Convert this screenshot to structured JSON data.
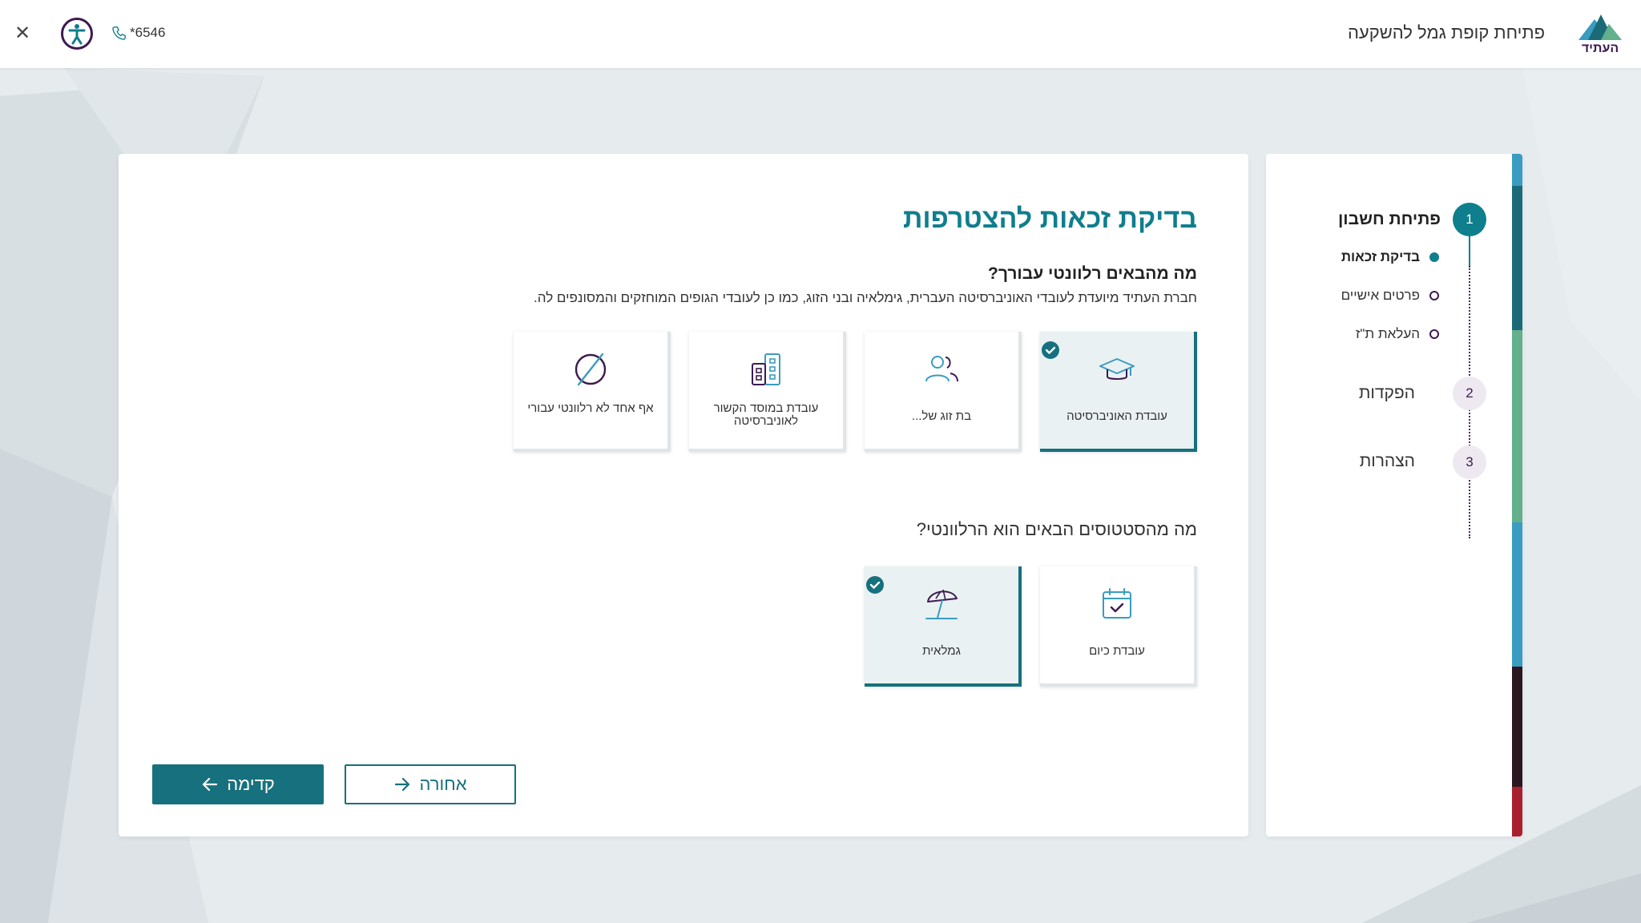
{
  "header": {
    "logo_text": "העתיד",
    "app_title": "פתיחת קופת גמל להשקעה",
    "phone": "*6546",
    "close_icon": "close-icon",
    "accessibility_icon": "accessibility-icon"
  },
  "stepper": {
    "steps": [
      {
        "number": "1",
        "label": "פתיחת חשבון",
        "active": true
      },
      {
        "number": "2",
        "label": "הפקדות",
        "active": false
      },
      {
        "number": "3",
        "label": "הצהרות",
        "active": false
      }
    ],
    "substeps": [
      {
        "label": "בדיקת זכאות",
        "current": true
      },
      {
        "label": "פרטים אישיים",
        "current": false
      },
      {
        "label": "העלאת ת\"ז",
        "current": false
      }
    ],
    "stripe_colors": [
      "#3a9cc0",
      "#1b6a78",
      "#62b08c",
      "#3a9cc0",
      "#2b1720",
      "#a8202e"
    ]
  },
  "main": {
    "title": "בדיקת זכאות להצטרפות",
    "question1": {
      "title": "מה מהבאים רלוונטי עבורך?",
      "description": "חברת העתיד מיועדת לעובדי האוניברסיטה העברית, גימלאיה ובני הזוג, כמו כן לעובדי הגופים המוחזקים והמסונפים לה.",
      "options": [
        {
          "label": "עובדת האוניברסיטה",
          "icon": "graduation-cap-icon",
          "selected": true
        },
        {
          "label": "בת זוג של...",
          "icon": "users-icon",
          "selected": false
        },
        {
          "label": "עובדת במוסד הקשור לאוניברסיטה",
          "icon": "building-icon",
          "selected": false
        },
        {
          "label": "אף אחד לא רלוונטי עבורי",
          "icon": "none-icon",
          "selected": false
        }
      ]
    },
    "question2": {
      "title": "מה מהסטטוסים הבאים הוא הרלוונטי?",
      "options": [
        {
          "label": "עובדת כיום",
          "icon": "calendar-check-icon",
          "selected": false
        },
        {
          "label": "גמלאית",
          "icon": "umbrella-icon",
          "selected": true
        }
      ]
    },
    "buttons": {
      "next_label": "קדימה",
      "back_label": "אחורה"
    }
  },
  "colors": {
    "primary": "#17707d",
    "accent_purple": "#3d1a4f",
    "selected_bg": "#eaf1f3"
  }
}
